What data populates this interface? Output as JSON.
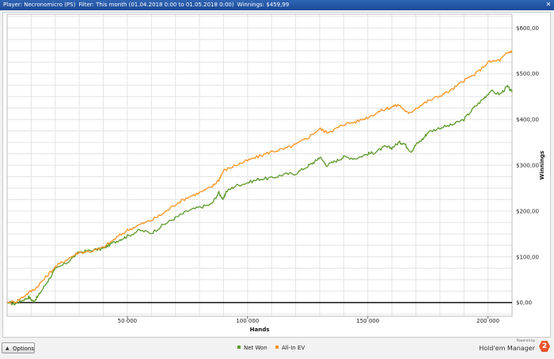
{
  "header": {
    "player": "Player: Necronomicro (PS)",
    "filter": "Filter: This month (01.04.2018 0:00 to 01.05.2018 0:00)",
    "winnings": "Winnings: $459,99",
    "close_icon": "close-icon"
  },
  "options_label": "Options",
  "legend": [
    {
      "name": "Net Won",
      "color": "#5c9a2a"
    },
    {
      "name": "All-In EV",
      "color": "#f7931e"
    }
  ],
  "brand": {
    "powered": "Powered by",
    "name": "Hold'em Manager",
    "logo_text": "2"
  },
  "chart_data": {
    "type": "line",
    "xlabel": "Hands",
    "ylabel": "Winnings",
    "xlim": [
      0,
      210000
    ],
    "ylim": [
      -30,
      630
    ],
    "x_ticks": [
      "50 000",
      "100 000",
      "150 000",
      "200 000"
    ],
    "y_ticks": [
      "$0,00",
      "$100,00",
      "$200,00",
      "$300,00",
      "$400,00",
      "$500,00",
      "$600,00"
    ],
    "grid": true,
    "legend_position": "bottom-center",
    "series": [
      {
        "name": "Net Won",
        "color": "#5c9a2a",
        "points": [
          [
            0,
            0
          ],
          [
            3000,
            -3
          ],
          [
            6000,
            4
          ],
          [
            9000,
            12
          ],
          [
            11000,
            2
          ],
          [
            13000,
            15
          ],
          [
            16000,
            40
          ],
          [
            20000,
            72
          ],
          [
            25000,
            88
          ],
          [
            30000,
            110
          ],
          [
            35000,
            114
          ],
          [
            40000,
            118
          ],
          [
            43000,
            128
          ],
          [
            47000,
            138
          ],
          [
            50000,
            145
          ],
          [
            55000,
            158
          ],
          [
            60000,
            152
          ],
          [
            65000,
            170
          ],
          [
            70000,
            185
          ],
          [
            75000,
            200
          ],
          [
            80000,
            208
          ],
          [
            85000,
            215
          ],
          [
            88000,
            240
          ],
          [
            90000,
            225
          ],
          [
            91000,
            242
          ],
          [
            95000,
            255
          ],
          [
            100000,
            262
          ],
          [
            105000,
            270
          ],
          [
            110000,
            272
          ],
          [
            115000,
            280
          ],
          [
            120000,
            282
          ],
          [
            125000,
            298
          ],
          [
            128000,
            308
          ],
          [
            130000,
            318
          ],
          [
            133000,
            300
          ],
          [
            137000,
            310
          ],
          [
            140000,
            318
          ],
          [
            145000,
            315
          ],
          [
            150000,
            325
          ],
          [
            153000,
            328
          ],
          [
            157000,
            340
          ],
          [
            160000,
            338
          ],
          [
            163000,
            350
          ],
          [
            165000,
            348
          ],
          [
            168000,
            330
          ],
          [
            170000,
            345
          ],
          [
            173000,
            358
          ],
          [
            175000,
            372
          ],
          [
            180000,
            382
          ],
          [
            185000,
            388
          ],
          [
            190000,
            400
          ],
          [
            194000,
            425
          ],
          [
            198000,
            445
          ],
          [
            201000,
            462
          ],
          [
            205000,
            455
          ],
          [
            208000,
            472
          ],
          [
            210000,
            460
          ]
        ]
      },
      {
        "name": "All-In EV",
        "color": "#f7931e",
        "points": [
          [
            0,
            0
          ],
          [
            4000,
            3
          ],
          [
            8000,
            18
          ],
          [
            12000,
            32
          ],
          [
            16000,
            55
          ],
          [
            20000,
            78
          ],
          [
            25000,
            95
          ],
          [
            30000,
            110
          ],
          [
            35000,
            112
          ],
          [
            40000,
            120
          ],
          [
            45000,
            140
          ],
          [
            50000,
            158
          ],
          [
            55000,
            170
          ],
          [
            60000,
            180
          ],
          [
            65000,
            195
          ],
          [
            70000,
            215
          ],
          [
            75000,
            230
          ],
          [
            80000,
            240
          ],
          [
            85000,
            252
          ],
          [
            88000,
            268
          ],
          [
            90000,
            288
          ],
          [
            95000,
            300
          ],
          [
            100000,
            310
          ],
          [
            105000,
            320
          ],
          [
            110000,
            330
          ],
          [
            115000,
            335
          ],
          [
            120000,
            345
          ],
          [
            125000,
            360
          ],
          [
            130000,
            380
          ],
          [
            133000,
            372
          ],
          [
            137000,
            380
          ],
          [
            140000,
            390
          ],
          [
            145000,
            395
          ],
          [
            150000,
            405
          ],
          [
            155000,
            418
          ],
          [
            160000,
            428
          ],
          [
            163000,
            432
          ],
          [
            167000,
            412
          ],
          [
            170000,
            425
          ],
          [
            175000,
            440
          ],
          [
            180000,
            452
          ],
          [
            185000,
            465
          ],
          [
            190000,
            485
          ],
          [
            195000,
            500
          ],
          [
            200000,
            525
          ],
          [
            205000,
            530
          ],
          [
            208000,
            545
          ],
          [
            210000,
            550
          ]
        ]
      }
    ]
  }
}
